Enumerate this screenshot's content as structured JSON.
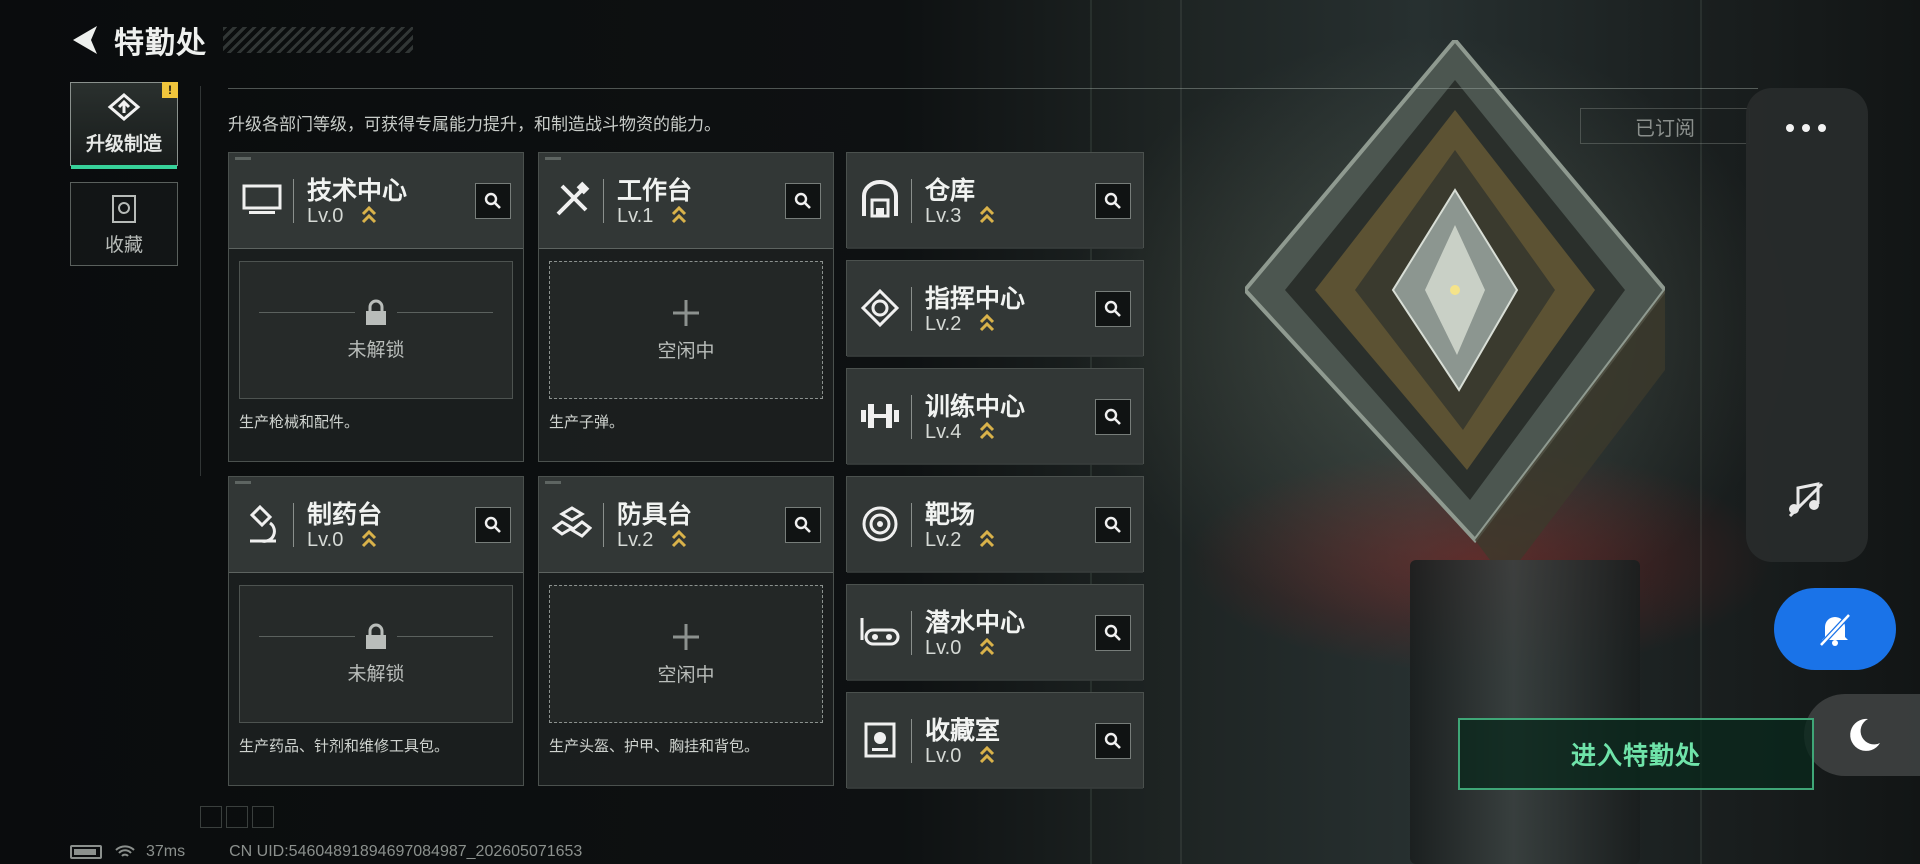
{
  "header": {
    "title": "特勤处"
  },
  "sidebar": {
    "tabs": [
      {
        "label": "升级制造",
        "active": true,
        "notify": "!"
      },
      {
        "label": "收藏",
        "active": false
      }
    ]
  },
  "description": "升级各部门等级，可获得专属能力提升，和制造战斗物资的能力。",
  "departments_large": [
    {
      "name": "技术中心",
      "level": "Lv.0",
      "slot_status": "未解锁",
      "note": "生产枪械和配件。"
    },
    {
      "name": "工作台",
      "level": "Lv.1",
      "slot_status": "空闲中",
      "note": "生产子弹。"
    },
    {
      "name": "制药台",
      "level": "Lv.0",
      "slot_status": "未解锁",
      "note": "生产药品、针剂和维修工具包。"
    },
    {
      "name": "防具台",
      "level": "Lv.2",
      "slot_status": "空闲中",
      "note": "生产头盔、护甲、胸挂和背包。"
    }
  ],
  "departments_small": [
    {
      "name": "仓库",
      "level": "Lv.3"
    },
    {
      "name": "指挥中心",
      "level": "Lv.2"
    },
    {
      "name": "训练中心",
      "level": "Lv.4"
    },
    {
      "name": "靶场",
      "level": "Lv.2"
    },
    {
      "name": "潜水中心",
      "level": "Lv.0"
    },
    {
      "name": "收藏室",
      "level": "Lv.0"
    }
  ],
  "right": {
    "subscribed_label": "已订阅",
    "enter_button": "进入特勤处"
  },
  "status_bar": {
    "ping": "37ms",
    "uid": "CN UID:54604891894697084987_202605071653"
  },
  "colors": {
    "accent_green": "#37d29a",
    "chevron_gold": "#d9b24a",
    "float_blue": "#1a73e8"
  }
}
